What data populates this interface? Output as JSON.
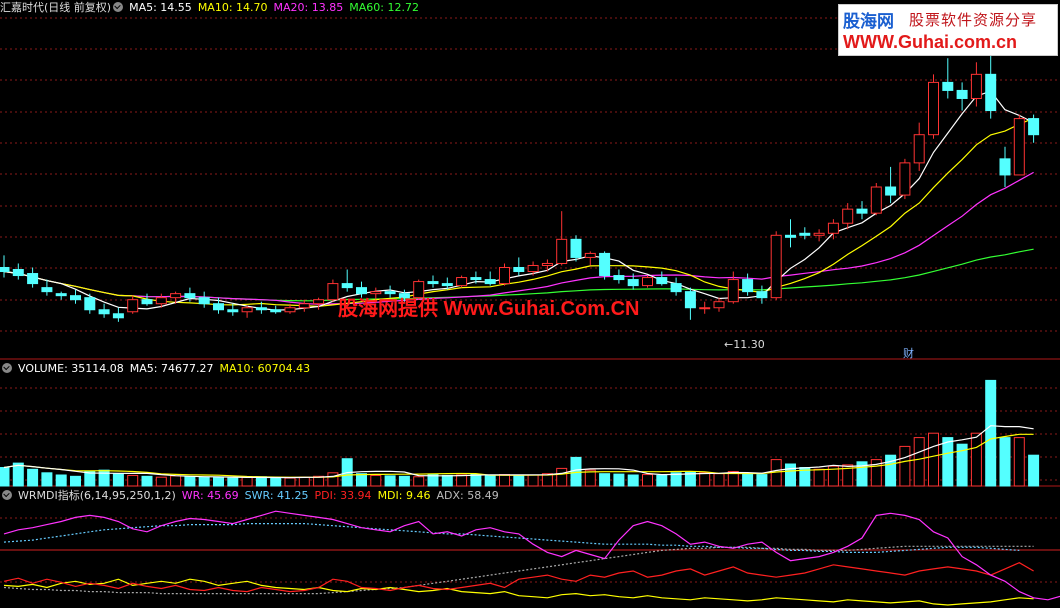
{
  "main_legend": {
    "title": "汇嘉时代(日线 前复权)",
    "items": [
      {
        "label": "MA5: 14.55",
        "color": "#ffffff"
      },
      {
        "label": "MA10: 14.70",
        "color": "#ffff00"
      },
      {
        "label": "MA20: 13.85",
        "color": "#ff33ff"
      },
      {
        "label": "MA60: 12.72",
        "color": "#33ff33"
      }
    ]
  },
  "volume_legend": {
    "items": [
      {
        "label": "VOLUME: 35114.08",
        "color": "#ffffff"
      },
      {
        "label": "MA5: 74677.27",
        "color": "#ffffff"
      },
      {
        "label": "MA10: 60704.43",
        "color": "#ffff00"
      }
    ]
  },
  "indicator_legend": {
    "title": "WRMDI指标(6,14,95,250,1,2)",
    "items": [
      {
        "label": "WR: 45.69",
        "color": "#ff33ff"
      },
      {
        "label": "SWR: 41.25",
        "color": "#66ccff"
      },
      {
        "label": "PDI: 33.94",
        "color": "#ff2020"
      },
      {
        "label": "MDI: 9.46",
        "color": "#ffff00"
      },
      {
        "label": "ADX: 58.49",
        "color": "#bbbbbb"
      }
    ]
  },
  "logo": {
    "line1": "股海网",
    "line2": "股票软件资源分享",
    "line3": "WWW.Guhai.com.cn"
  },
  "watermark": "股海网提供 Www.Guhai.Com.CN",
  "low_marker": "11.30",
  "event_marker": "财",
  "colors": {
    "up": "#ff3333",
    "down": "#54ffff",
    "grid": "#8a1a1a",
    "bg": "#000000"
  },
  "chart_data": {
    "type": "candlestick",
    "price_ylim": [
      10.5,
      18.8
    ],
    "candles": [
      {
        "o": 12.6,
        "h": 12.9,
        "l": 12.35,
        "c": 12.5
      },
      {
        "o": 12.55,
        "h": 12.7,
        "l": 12.3,
        "c": 12.4
      },
      {
        "o": 12.45,
        "h": 12.6,
        "l": 12.1,
        "c": 12.2
      },
      {
        "o": 12.1,
        "h": 12.3,
        "l": 11.9,
        "c": 12.0
      },
      {
        "o": 11.95,
        "h": 12.0,
        "l": 11.8,
        "c": 11.9
      },
      {
        "o": 11.9,
        "h": 12.05,
        "l": 11.7,
        "c": 11.8
      },
      {
        "o": 11.85,
        "h": 11.95,
        "l": 11.45,
        "c": 11.55
      },
      {
        "o": 11.55,
        "h": 11.7,
        "l": 11.35,
        "c": 11.45
      },
      {
        "o": 11.45,
        "h": 11.6,
        "l": 11.25,
        "c": 11.35
      },
      {
        "o": 11.5,
        "h": 11.9,
        "l": 11.45,
        "c": 11.8
      },
      {
        "o": 11.8,
        "h": 11.95,
        "l": 11.65,
        "c": 11.7
      },
      {
        "o": 11.7,
        "h": 11.95,
        "l": 11.6,
        "c": 11.85
      },
      {
        "o": 11.85,
        "h": 12.0,
        "l": 11.7,
        "c": 11.95
      },
      {
        "o": 11.95,
        "h": 12.1,
        "l": 11.75,
        "c": 11.85
      },
      {
        "o": 11.85,
        "h": 12.0,
        "l": 11.6,
        "c": 11.7
      },
      {
        "o": 11.7,
        "h": 11.85,
        "l": 11.45,
        "c": 11.55
      },
      {
        "o": 11.55,
        "h": 11.7,
        "l": 11.4,
        "c": 11.5
      },
      {
        "o": 11.5,
        "h": 11.65,
        "l": 11.35,
        "c": 11.6
      },
      {
        "o": 11.6,
        "h": 11.75,
        "l": 11.45,
        "c": 11.55
      },
      {
        "o": 11.55,
        "h": 11.65,
        "l": 11.45,
        "c": 11.5
      },
      {
        "o": 11.5,
        "h": 11.7,
        "l": 11.45,
        "c": 11.6
      },
      {
        "o": 11.6,
        "h": 11.8,
        "l": 11.5,
        "c": 11.7
      },
      {
        "o": 11.7,
        "h": 11.85,
        "l": 11.55,
        "c": 11.8
      },
      {
        "o": 11.8,
        "h": 12.3,
        "l": 11.75,
        "c": 12.2
      },
      {
        "o": 12.2,
        "h": 12.55,
        "l": 12.0,
        "c": 12.1
      },
      {
        "o": 12.1,
        "h": 12.25,
        "l": 11.85,
        "c": 11.95
      },
      {
        "o": 11.95,
        "h": 12.1,
        "l": 11.8,
        "c": 12.0
      },
      {
        "o": 12.0,
        "h": 12.15,
        "l": 11.85,
        "c": 11.95
      },
      {
        "o": 11.95,
        "h": 12.05,
        "l": 11.75,
        "c": 11.85
      },
      {
        "o": 11.85,
        "h": 12.3,
        "l": 11.8,
        "c": 12.25
      },
      {
        "o": 12.25,
        "h": 12.4,
        "l": 12.1,
        "c": 12.2
      },
      {
        "o": 12.2,
        "h": 12.35,
        "l": 12.05,
        "c": 12.15
      },
      {
        "o": 12.15,
        "h": 12.4,
        "l": 12.1,
        "c": 12.35
      },
      {
        "o": 12.35,
        "h": 12.5,
        "l": 12.2,
        "c": 12.3
      },
      {
        "o": 12.3,
        "h": 12.5,
        "l": 12.15,
        "c": 12.2
      },
      {
        "o": 12.2,
        "h": 12.7,
        "l": 12.15,
        "c": 12.6
      },
      {
        "o": 12.6,
        "h": 12.85,
        "l": 12.4,
        "c": 12.5
      },
      {
        "o": 12.5,
        "h": 12.75,
        "l": 12.4,
        "c": 12.65
      },
      {
        "o": 12.65,
        "h": 12.8,
        "l": 12.5,
        "c": 12.7
      },
      {
        "o": 12.7,
        "h": 14.0,
        "l": 12.65,
        "c": 13.3
      },
      {
        "o": 13.3,
        "h": 13.4,
        "l": 12.75,
        "c": 12.85
      },
      {
        "o": 12.85,
        "h": 13.0,
        "l": 12.65,
        "c": 12.95
      },
      {
        "o": 12.95,
        "h": 13.0,
        "l": 12.3,
        "c": 12.4
      },
      {
        "o": 12.4,
        "h": 12.55,
        "l": 12.2,
        "c": 12.3
      },
      {
        "o": 12.3,
        "h": 12.45,
        "l": 12.05,
        "c": 12.15
      },
      {
        "o": 12.15,
        "h": 12.4,
        "l": 12.1,
        "c": 12.35
      },
      {
        "o": 12.35,
        "h": 12.5,
        "l": 12.15,
        "c": 12.2
      },
      {
        "o": 12.2,
        "h": 12.35,
        "l": 11.9,
        "c": 12.0
      },
      {
        "o": 12.0,
        "h": 12.1,
        "l": 11.3,
        "c": 11.6
      },
      {
        "o": 11.6,
        "h": 11.75,
        "l": 11.45,
        "c": 11.6
      },
      {
        "o": 11.6,
        "h": 11.85,
        "l": 11.5,
        "c": 11.75
      },
      {
        "o": 11.75,
        "h": 12.5,
        "l": 11.7,
        "c": 12.3
      },
      {
        "o": 12.3,
        "h": 12.45,
        "l": 11.9,
        "c": 12.0
      },
      {
        "o": 12.0,
        "h": 12.15,
        "l": 11.7,
        "c": 11.85
      },
      {
        "o": 11.85,
        "h": 13.5,
        "l": 11.8,
        "c": 13.4
      },
      {
        "o": 13.4,
        "h": 13.8,
        "l": 13.1,
        "c": 13.35
      },
      {
        "o": 13.45,
        "h": 13.6,
        "l": 13.3,
        "c": 13.4
      },
      {
        "o": 13.4,
        "h": 13.55,
        "l": 13.25,
        "c": 13.45
      },
      {
        "o": 13.45,
        "h": 13.8,
        "l": 13.3,
        "c": 13.7
      },
      {
        "o": 13.7,
        "h": 14.2,
        "l": 13.55,
        "c": 14.05
      },
      {
        "o": 14.05,
        "h": 14.25,
        "l": 13.8,
        "c": 13.95
      },
      {
        "o": 13.95,
        "h": 14.7,
        "l": 13.9,
        "c": 14.6
      },
      {
        "o": 14.6,
        "h": 15.1,
        "l": 14.2,
        "c": 14.4
      },
      {
        "o": 14.4,
        "h": 15.3,
        "l": 14.3,
        "c": 15.2
      },
      {
        "o": 15.2,
        "h": 16.2,
        "l": 15.0,
        "c": 15.9
      },
      {
        "o": 15.9,
        "h": 17.4,
        "l": 15.8,
        "c": 17.2
      },
      {
        "o": 17.2,
        "h": 17.8,
        "l": 16.8,
        "c": 17.0
      },
      {
        "o": 17.0,
        "h": 17.2,
        "l": 16.5,
        "c": 16.8
      },
      {
        "o": 16.8,
        "h": 17.7,
        "l": 16.6,
        "c": 17.4
      },
      {
        "o": 17.4,
        "h": 18.6,
        "l": 16.3,
        "c": 16.5
      },
      {
        "o": 15.3,
        "h": 15.6,
        "l": 14.6,
        "c": 14.9
      },
      {
        "o": 14.9,
        "h": 16.4,
        "l": 14.9,
        "c": 16.3
      },
      {
        "o": 16.3,
        "h": 16.4,
        "l": 15.7,
        "c": 15.9
      }
    ],
    "volume_ylim": [
      0,
      250000
    ],
    "volume": [
      42000,
      52000,
      38000,
      30000,
      25000,
      22000,
      33000,
      36000,
      28000,
      24000,
      22000,
      20000,
      23000,
      21000,
      20000,
      19000,
      18000,
      20000,
      21000,
      19000,
      18000,
      20000,
      22000,
      30000,
      62000,
      28000,
      24000,
      23000,
      22000,
      21000,
      26000,
      24000,
      25000,
      27000,
      25000,
      26000,
      24000,
      25000,
      28000,
      40000,
      65000,
      36000,
      28000,
      27000,
      25000,
      26000,
      24000,
      30000,
      32000,
      30000,
      28000,
      33000,
      29000,
      26000,
      60000,
      50000,
      42000,
      38000,
      45000,
      48000,
      55000,
      60000,
      70000,
      90000,
      110000,
      120000,
      110000,
      95000,
      120000,
      240000,
      110000,
      110000,
      70000
    ],
    "indicator_ylim": [
      0,
      100
    ],
    "wr": [
      70,
      74,
      76,
      79,
      82,
      86,
      88,
      86,
      82,
      75,
      72,
      78,
      82,
      85,
      84,
      82,
      80,
      84,
      88,
      92,
      90,
      88,
      86,
      84,
      80,
      76,
      74,
      72,
      78,
      82,
      70,
      72,
      68,
      74,
      76,
      72,
      70,
      60,
      52,
      48,
      54,
      50,
      46,
      64,
      78,
      82,
      78,
      70,
      60,
      62,
      58,
      56,
      60,
      62,
      52,
      44,
      46,
      48,
      52,
      58,
      66,
      88,
      90,
      88,
      84,
      72,
      66,
      48,
      40,
      30,
      24,
      14,
      8,
      6,
      10,
      18,
      12,
      24,
      40,
      14,
      30
    ],
    "swr": [
      62,
      63,
      64,
      66,
      68,
      70,
      72,
      74,
      75,
      76,
      77,
      78,
      78,
      79,
      79,
      79,
      79,
      80,
      80,
      80,
      80,
      80,
      79,
      78,
      77,
      76,
      75,
      74,
      73,
      72,
      71,
      70,
      70,
      69,
      68,
      67,
      66,
      65,
      64,
      63,
      62,
      61,
      60,
      60,
      60,
      60,
      59,
      59,
      58,
      58,
      57,
      57,
      56,
      56,
      55,
      54,
      54,
      53,
      53,
      52,
      52,
      52,
      53,
      54,
      55,
      56,
      57,
      57,
      57,
      56,
      55,
      54
    ],
    "pdi": [
      24,
      27,
      22,
      26,
      23,
      19,
      22,
      20,
      17,
      22,
      19,
      17,
      20,
      16,
      15,
      18,
      15,
      14,
      18,
      16,
      14,
      15,
      18,
      26,
      24,
      18,
      17,
      15,
      18,
      20,
      17,
      16,
      18,
      20,
      22,
      18,
      26,
      28,
      30,
      26,
      24,
      30,
      28,
      32,
      34,
      28,
      30,
      34,
      36,
      30,
      34,
      38,
      32,
      30,
      28,
      30,
      32,
      36,
      40,
      38,
      36,
      34,
      32,
      30,
      34,
      36,
      38,
      36,
      34,
      30,
      36,
      42,
      34
    ],
    "mdi": [
      20,
      19,
      21,
      18,
      22,
      24,
      21,
      22,
      26,
      20,
      22,
      24,
      22,
      26,
      24,
      20,
      22,
      24,
      20,
      18,
      17,
      16,
      18,
      15,
      14,
      17,
      16,
      18,
      16,
      14,
      15,
      17,
      14,
      13,
      12,
      14,
      10,
      9,
      8,
      11,
      12,
      10,
      11,
      9,
      8,
      10,
      8,
      7,
      6,
      8,
      7,
      6,
      5,
      6,
      8,
      7,
      6,
      5,
      4,
      6,
      5,
      4,
      3,
      4,
      5,
      2,
      1,
      2,
      3,
      4,
      6,
      8,
      7
    ],
    "adx": [
      18,
      17,
      16,
      16,
      15,
      15,
      14,
      14,
      13,
      13,
      13,
      12,
      12,
      12,
      12,
      12,
      12,
      12,
      12,
      12,
      12,
      12,
      12,
      13,
      14,
      15,
      16,
      17,
      18,
      20,
      22,
      24,
      26,
      28,
      30,
      32,
      34,
      36,
      38,
      40,
      42,
      44,
      46,
      48,
      50,
      52,
      54,
      55,
      56,
      56,
      57,
      57,
      57,
      56,
      56,
      55,
      55,
      54,
      54,
      54,
      55,
      56,
      57,
      58,
      58,
      58,
      58,
      58,
      58,
      58,
      58,
      58,
      58
    ]
  }
}
